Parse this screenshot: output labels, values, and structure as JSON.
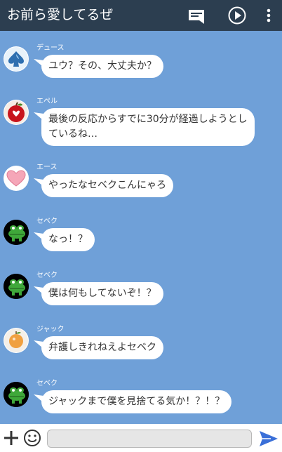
{
  "header": {
    "title": "お前ら愛してるぜ",
    "icons": [
      "message-icon",
      "play-icon",
      "more-vert-icon"
    ]
  },
  "messages": [
    {
      "sender": "デュース",
      "avatar": "spade-avatar",
      "text": "ユウ？その、大丈夫か？"
    },
    {
      "sender": "エペル",
      "avatar": "apple-avatar",
      "text": "最後の反応からすでに30分が経過しようとしているね…"
    },
    {
      "sender": "エース",
      "avatar": "heart-avatar",
      "text": "やったなセベクこんにゃろ"
    },
    {
      "sender": "セベク",
      "avatar": "crocodile-avatar",
      "text": "なっ！？"
    },
    {
      "sender": "セベク",
      "avatar": "crocodile-avatar",
      "text": "僕は何もしてないぞ！？"
    },
    {
      "sender": "ジャック",
      "avatar": "orange-avatar",
      "text": "弁護しきれねえよセベク"
    },
    {
      "sender": "セベク",
      "avatar": "crocodile-avatar",
      "text": "ジャックまで僕を見捨てる気か！？！？"
    }
  ],
  "composer": {
    "input_value": "",
    "icons": [
      "plus-icon",
      "smile-icon",
      "send-icon"
    ]
  },
  "colors": {
    "header_bg": "#2c3e50",
    "chat_bg": "#6fa0d8",
    "bubble_bg": "#ffffff",
    "send_icon": "#3a6fd8"
  }
}
